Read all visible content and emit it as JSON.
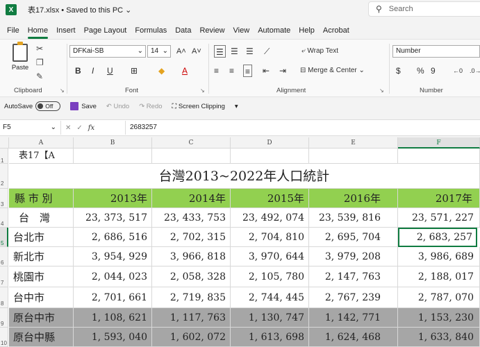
{
  "title_bar": {
    "app_icon": "X",
    "doc_title": "表17.xlsx • Saved to this PC ⌄",
    "search_placeholder": "Search"
  },
  "menu": {
    "tabs": [
      "File",
      "Home",
      "Insert",
      "Page Layout",
      "Formulas",
      "Data",
      "Review",
      "View",
      "Automate",
      "Help",
      "Acrobat"
    ],
    "active": "Home"
  },
  "ribbon": {
    "clipboard": {
      "paste_label": "Paste",
      "group_label": "Clipboard"
    },
    "font": {
      "font_name": "DFKai-SB",
      "font_size": "14",
      "bold": "B",
      "italic": "I",
      "underline": "U",
      "grow": "A˄",
      "shrink": "A˅",
      "group_label": "Font"
    },
    "alignment": {
      "wrap_text": "Wrap Text",
      "merge_center": "Merge & Center",
      "group_label": "Alignment"
    },
    "number": {
      "format": "Number",
      "currency": "$",
      "percent": "%",
      "comma": "9",
      "group_label": "Number"
    }
  },
  "qat": {
    "autosave_label": "AutoSave",
    "toggle_state": "Off",
    "save_label": "Save",
    "undo_label": "Undo",
    "redo_label": "Redo",
    "screen_clipping_label": "Screen Clipping"
  },
  "formula_bar": {
    "name_box": "F5",
    "fx": "fx",
    "value": "2683257"
  },
  "columns": [
    "A",
    "B",
    "C",
    "D",
    "E",
    "F"
  ],
  "rows": [
    "1",
    "2",
    "3",
    "4",
    "5",
    "6",
    "7",
    "8",
    "9",
    "10"
  ],
  "sheet": {
    "a1": "表17【A",
    "table_title": "台灣2013~2022年人口統計",
    "header": [
      "縣 市 別",
      "2013年",
      "2014年",
      "2015年",
      "2016年",
      "2017年"
    ],
    "data": [
      [
        "台　灣",
        "23, 373, 517",
        "23, 433, 753",
        "23, 492, 074",
        "23, 539, 816",
        "23, 571, 227"
      ],
      [
        "台北市",
        "2, 686, 516",
        "2, 702, 315",
        "2, 704, 810",
        "2, 695, 704",
        "2, 683, 257"
      ],
      [
        "新北市",
        "3, 954, 929",
        "3, 966, 818",
        "3, 970, 644",
        "3, 979, 208",
        "3, 986, 689"
      ],
      [
        "桃園市",
        "2, 044, 023",
        "2, 058, 328",
        "2, 105, 780",
        "2, 147, 763",
        "2, 188, 017"
      ],
      [
        "台中市",
        "2, 701, 661",
        "2, 719, 835",
        "2, 744, 445",
        "2, 767, 239",
        "2, 787, 070"
      ],
      [
        "原台中市",
        "1, 108, 621",
        "1, 117, 763",
        "1, 130, 747",
        "1, 142, 771",
        "1, 153, 230"
      ],
      [
        "原台中縣",
        "1, 593, 040",
        "1, 602, 072",
        "1, 613, 698",
        "1, 624, 468",
        "1, 633, 840"
      ]
    ]
  },
  "colors": {
    "accent": "#107c41",
    "header_fill": "#92d050",
    "subtotal_fill": "#a6a6a6"
  }
}
